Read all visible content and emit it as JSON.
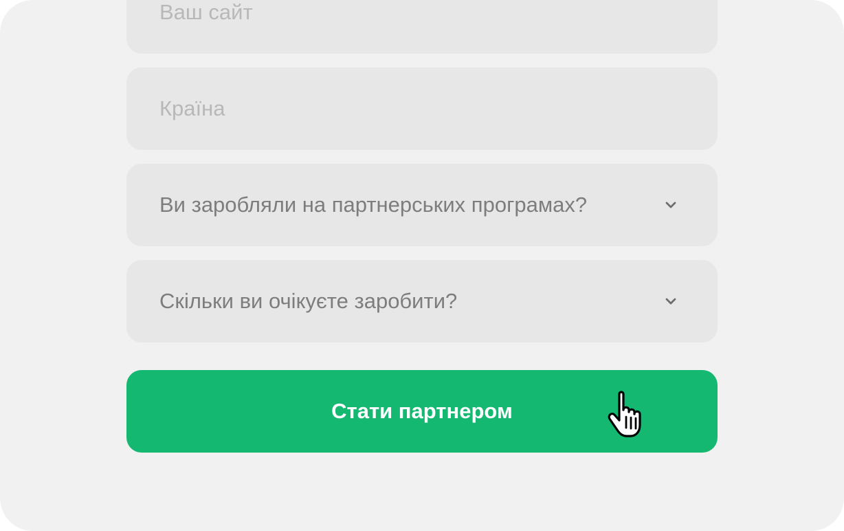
{
  "form": {
    "website_placeholder": "Ваш сайт",
    "country_placeholder": "Країна",
    "affiliate_question": "Ви заробляли на партнерських програмах?",
    "earnings_question": "Скільки ви очікуєте заробити?",
    "submit_label": "Стати партнером"
  },
  "icons": {
    "dropdown": "chevron-down-icon",
    "cursor": "hand-pointer-icon"
  },
  "colors": {
    "card_background": "#f1f1f1",
    "field_background": "#e7e7e7",
    "accent": "#15b871",
    "placeholder_text": "#b8b8b8",
    "select_text": "#7d7d7d"
  }
}
